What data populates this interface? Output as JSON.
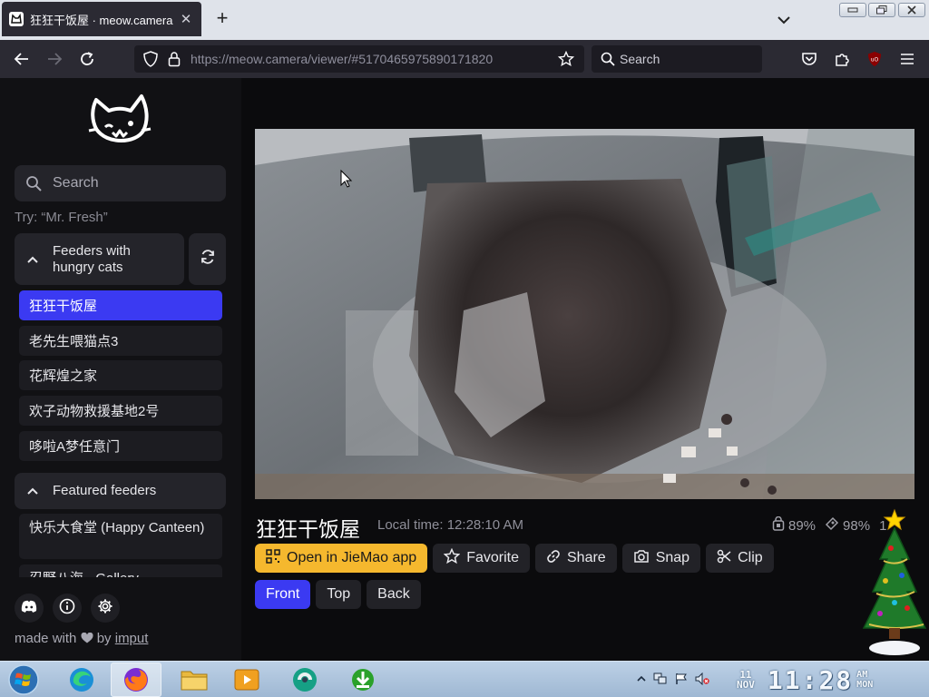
{
  "browser": {
    "tab_title": "狂狂干饭屋 · meow.camera",
    "url_host": "https://meow.camera",
    "url_path": "/viewer/#5170465975890171820",
    "search_placeholder": "Search"
  },
  "sidebar": {
    "search_placeholder": "Search",
    "hint": "Try: “Mr. Fresh”",
    "hungry_group_label": "Feeders with hungry cats",
    "hungry_feeders": [
      "狂狂干饭屋",
      "老先生喂猫点3",
      "花辉煌之家",
      "欢子动物救援基地2号",
      "哆啦A梦任意门"
    ],
    "featured_group_label": "Featured feeders",
    "featured_feeders": [
      "快乐大食堂 (Happy Canteen)",
      "忍野八海 · Gallery"
    ],
    "footer_text": "made with",
    "footer_by": "by",
    "footer_link": "imput"
  },
  "viewer": {
    "camera_name": "狂狂干饭屋",
    "local_time_label": "Local time:",
    "local_time": "12:28:10 AM",
    "battery": "89%",
    "food": "98%",
    "viewers": "1",
    "buttons": {
      "open_app": "Open in JieMao app",
      "favorite": "Favorite",
      "share": "Share",
      "snap": "Snap",
      "clip": "Clip"
    },
    "views": [
      "Front",
      "Top",
      "Back"
    ]
  },
  "taskbar": {
    "date_day": "11",
    "date_month": "NOV",
    "time": "11:28",
    "ampm_top": "AM",
    "ampm_bottom": "MON"
  },
  "colors": {
    "accent": "#3b3af2",
    "primary_button": "#f5b82e"
  }
}
